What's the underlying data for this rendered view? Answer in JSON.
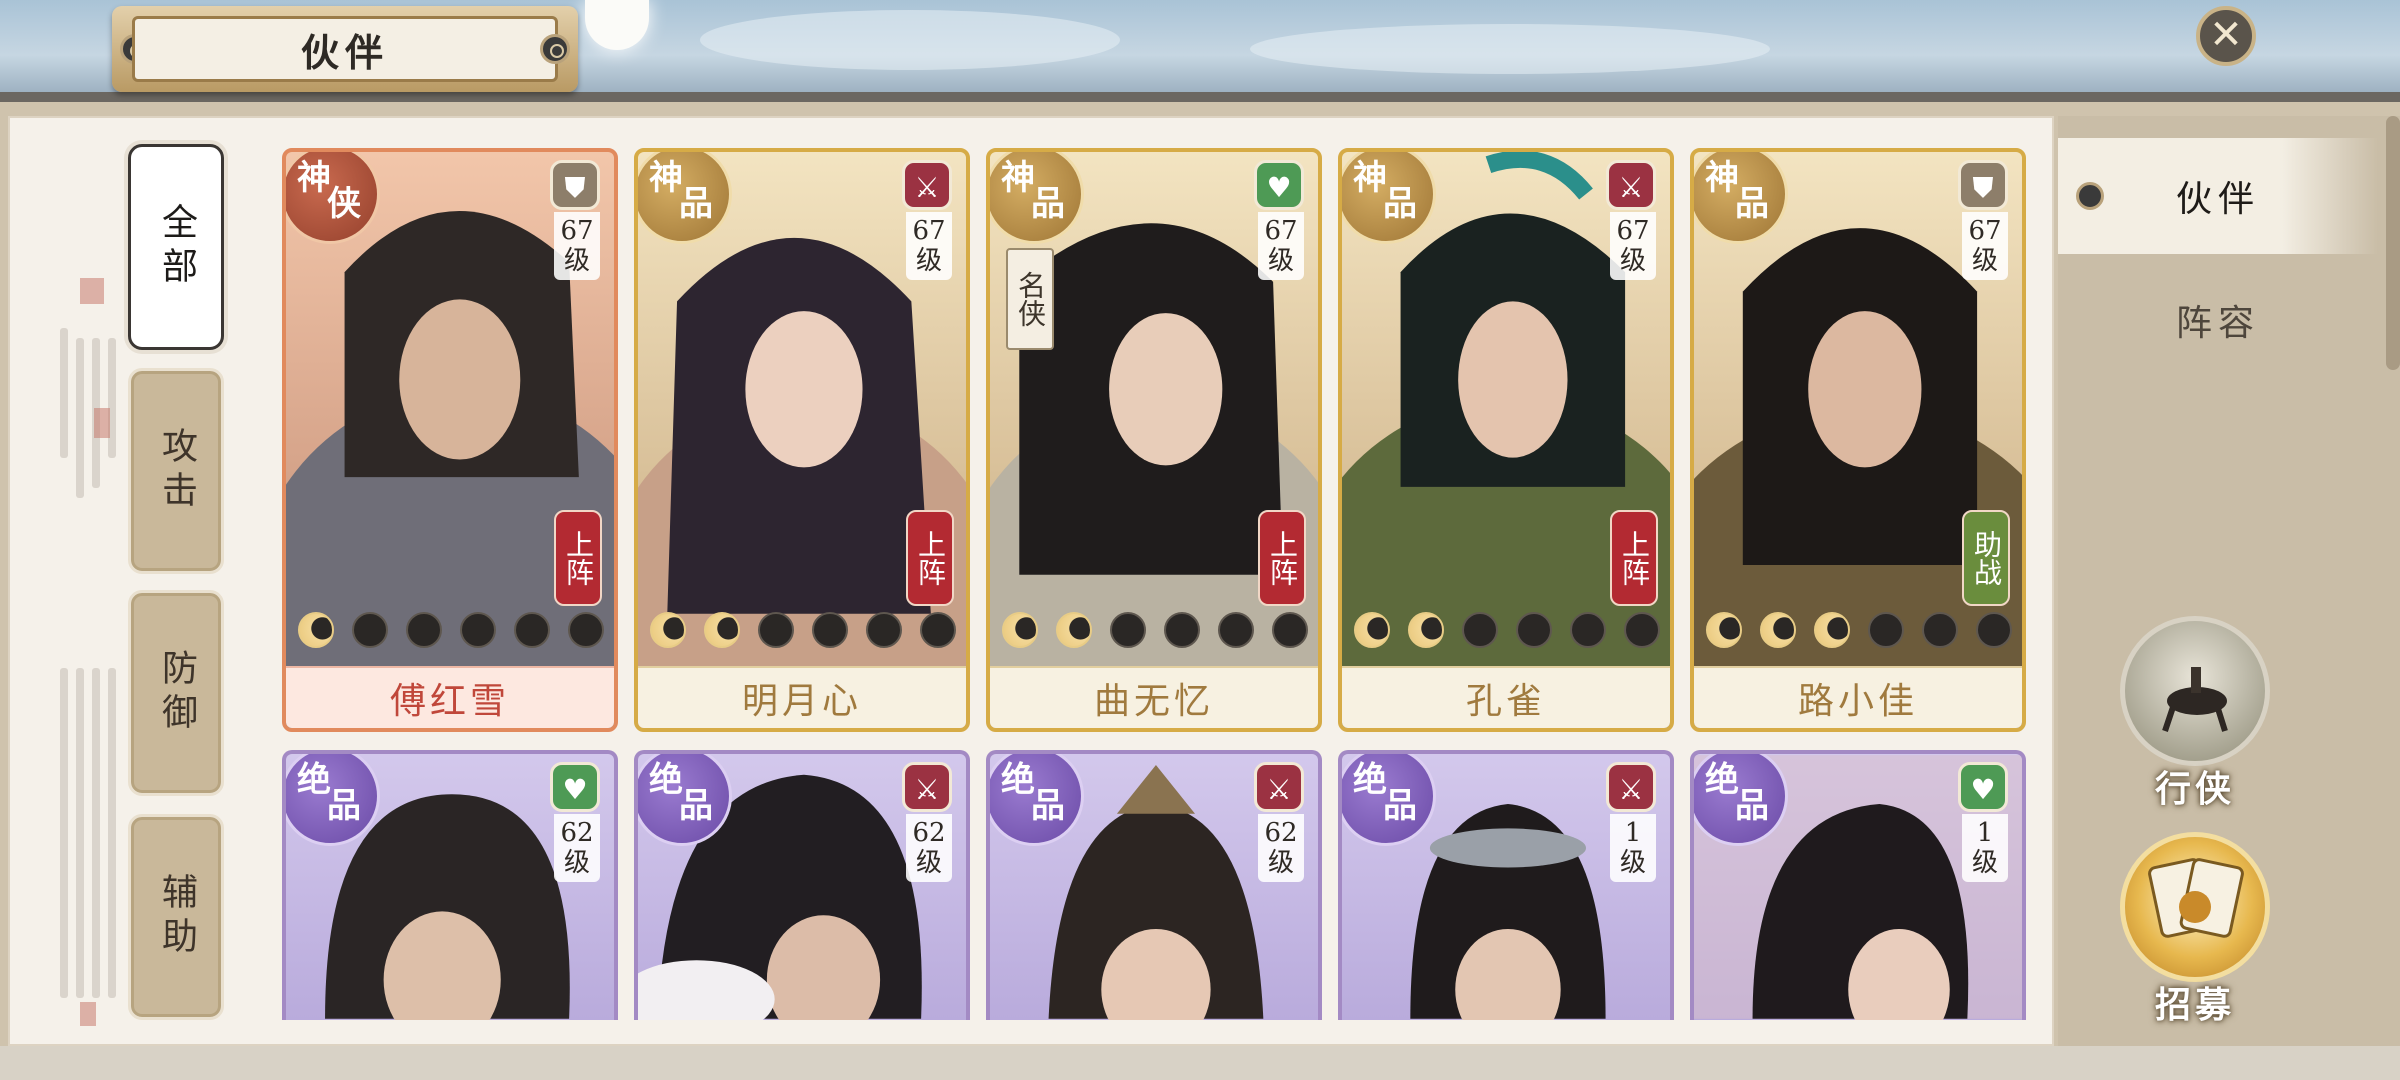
{
  "header": {
    "title": "伙伴",
    "close_icon": "close-icon"
  },
  "categories": [
    {
      "label": "全部",
      "active": true
    },
    {
      "label": "攻击",
      "active": false
    },
    {
      "label": "防御",
      "active": false
    },
    {
      "label": "辅助",
      "active": false
    }
  ],
  "right_tabs": [
    {
      "label": "伙伴",
      "active": true
    },
    {
      "label": "阵容",
      "active": false
    }
  ],
  "side_buttons": [
    {
      "label": "行侠",
      "icon": "horse-rider-icon"
    },
    {
      "label": "招募",
      "icon": "recruit-cards-icon"
    }
  ],
  "partners": [
    {
      "name": "傅红雪",
      "rank_1": "神",
      "rank_2": "侠",
      "class_icon": "shield-icon",
      "level_num": "67",
      "level_unit": "级",
      "status": "上阵",
      "stars_lit": 1,
      "stars_total": 6
    },
    {
      "name": "明月心",
      "rank_1": "神",
      "rank_2": "品",
      "class_icon": "crossed-swords-icon",
      "level_num": "67",
      "level_unit": "级",
      "status": "上阵",
      "stars_lit": 2,
      "stars_total": 6
    },
    {
      "name": "曲无忆",
      "rank_1": "神",
      "rank_2": "品",
      "class_icon": "heart-icon",
      "level_num": "67",
      "level_unit": "级",
      "status": "上阵",
      "fame_tag": "名侠",
      "stars_lit": 2,
      "stars_total": 6
    },
    {
      "name": "孔雀",
      "rank_1": "神",
      "rank_2": "品",
      "class_icon": "crossed-swords-icon",
      "level_num": "67",
      "level_unit": "级",
      "status": "上阵",
      "stars_lit": 2,
      "stars_total": 6
    },
    {
      "name": "路小佳",
      "rank_1": "神",
      "rank_2": "品",
      "class_icon": "shield-icon",
      "level_num": "67",
      "level_unit": "级",
      "status": "助战",
      "stars_lit": 3,
      "stars_total": 6
    },
    {
      "rank_1": "绝",
      "rank_2": "品",
      "class_icon": "heart-icon",
      "level_num": "62",
      "level_unit": "级"
    },
    {
      "rank_1": "绝",
      "rank_2": "品",
      "class_icon": "crossed-swords-icon",
      "level_num": "62",
      "level_unit": "级"
    },
    {
      "rank_1": "绝",
      "rank_2": "品",
      "class_icon": "crossed-swords-icon",
      "level_num": "62",
      "level_unit": "级"
    },
    {
      "rank_1": "绝",
      "rank_2": "品",
      "class_icon": "crossed-swords-icon",
      "level_num": "1",
      "level_unit": "级"
    },
    {
      "rank_1": "绝",
      "rank_2": "品",
      "class_icon": "heart-icon",
      "level_num": "1",
      "level_unit": "级"
    }
  ],
  "colors": {
    "god_gold": "#d6ab46",
    "god_red": "#e18a5d",
    "jue_purple": "#a38ac4",
    "deploy_red": "#b32a32",
    "assist_green": "#6a8d3d"
  }
}
